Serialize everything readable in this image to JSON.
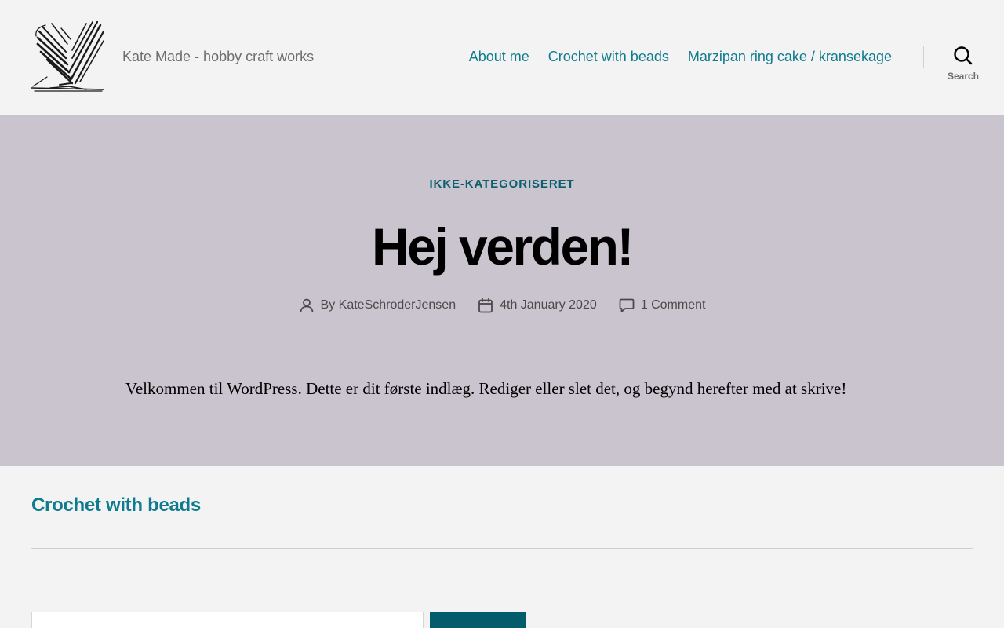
{
  "site": {
    "logo_icon": "hand-drawn-heart-logo-icon",
    "tagline": "Kate Made - hobby craft works"
  },
  "nav": {
    "items": [
      {
        "label": "About me"
      },
      {
        "label": "Crochet with beads"
      },
      {
        "label": "Marzipan ring cake / kransekage"
      }
    ],
    "search_label": "Search",
    "search_icon": "search-icon"
  },
  "post": {
    "category": "IKKE-KATEGORISERET",
    "title": "Hej verden!",
    "author_prefix": "By",
    "author": "KateSchroderJensen",
    "author_icon": "user-icon",
    "date": "4th January 2020",
    "date_icon": "calendar-icon",
    "comments": "1 Comment",
    "comments_icon": "comment-icon",
    "content": "Velkommen til WordPress. Dette er dit første indlæg. Rediger eller slet det, og begynd herefter med at skrive!"
  },
  "widget": {
    "title": "Crochet with beads"
  },
  "colors": {
    "background": "#f3f3f3",
    "hero_background": "#cac4ce",
    "accent": "#0f7b8f",
    "category": "#0c5f6e",
    "button": "#045b6b"
  }
}
